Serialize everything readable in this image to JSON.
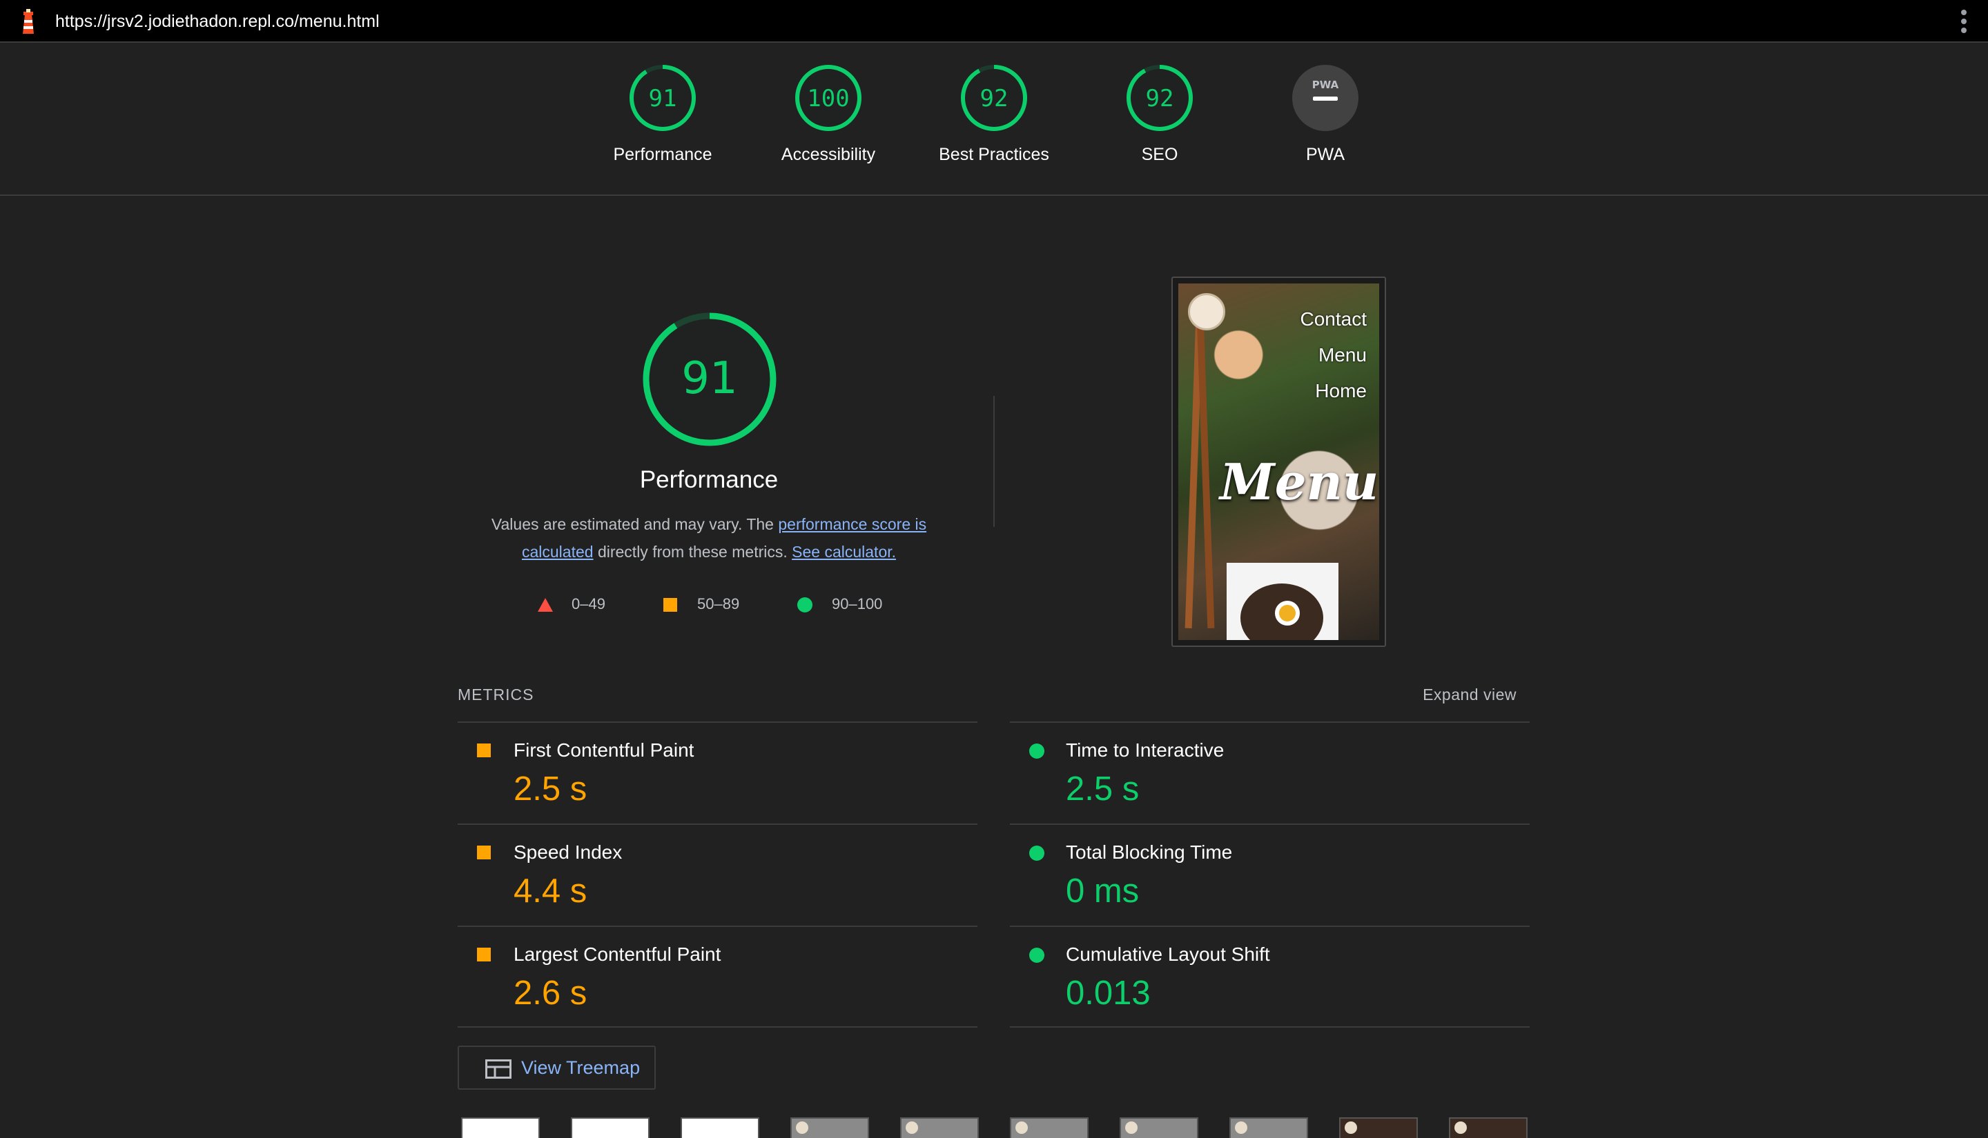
{
  "window": {
    "url": "https://jrsv2.jodiethadon.repl.co/menu.html",
    "logo_icon": "lighthouse-icon",
    "menu_icon": "kebab-menu-icon"
  },
  "colors": {
    "pass": "#0cce6b",
    "average": "#ffa400",
    "fail": "#ff4e42",
    "link": "#8ab4f8",
    "background": "#212121"
  },
  "categories": [
    {
      "label": "Performance",
      "score": "91",
      "fraction": 0.91
    },
    {
      "label": "Accessibility",
      "score": "100",
      "fraction": 1.0
    },
    {
      "label": "Best Practices",
      "score": "92",
      "fraction": 0.92
    },
    {
      "label": "SEO",
      "score": "92",
      "fraction": 0.92
    },
    {
      "label": "PWA",
      "score": "PWA",
      "badge": "–"
    }
  ],
  "performance": {
    "score": "91",
    "fraction": 0.91,
    "title": "Performance",
    "desc_prefix": "Values are estimated and may vary. The ",
    "desc_link1": "performance score is calculated",
    "desc_middle": " directly from these metrics. ",
    "desc_link2": "See calculator.",
    "legend": [
      {
        "range": "0–49",
        "shape": "triangle"
      },
      {
        "range": "50–89",
        "shape": "square"
      },
      {
        "range": "90–100",
        "shape": "circle"
      }
    ]
  },
  "screenshot": {
    "nav": [
      "Contact",
      "Menu",
      "Home"
    ],
    "hero": "Menu"
  },
  "metrics": {
    "title": "METRICS",
    "expand": "Expand view",
    "left": [
      {
        "name": "First Contentful Paint",
        "value": "2.5 s",
        "rating": "average"
      },
      {
        "name": "Speed Index",
        "value": "4.4 s",
        "rating": "average"
      },
      {
        "name": "Largest Contentful Paint",
        "value": "2.6 s",
        "rating": "average"
      }
    ],
    "right": [
      {
        "name": "Time to Interactive",
        "value": "2.5 s",
        "rating": "pass"
      },
      {
        "name": "Total Blocking Time",
        "value": "0 ms",
        "rating": "pass"
      },
      {
        "name": "Cumulative Layout Shift",
        "value": "0.013",
        "rating": "pass"
      }
    ]
  },
  "treemap": {
    "label": "View Treemap",
    "icon": "treemap-icon"
  }
}
